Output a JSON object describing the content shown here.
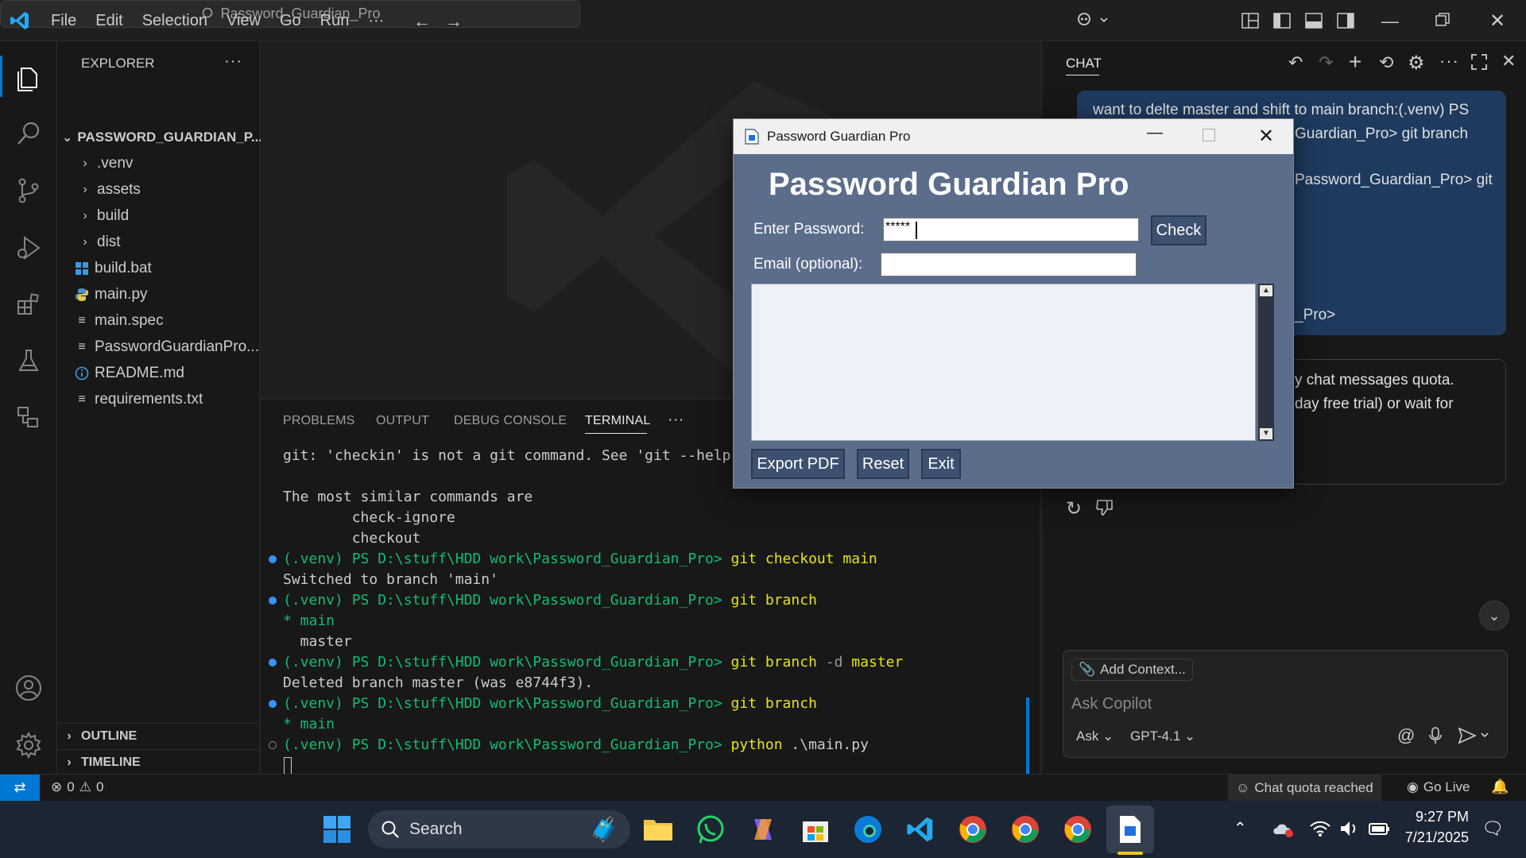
{
  "menubar": {
    "items": [
      "File",
      "Edit",
      "Selection",
      "View",
      "Go",
      "Run",
      "···"
    ],
    "search_text": "Password_Guardian_Pro"
  },
  "explorer": {
    "header": "EXPLORER",
    "root": "PASSWORD_GUARDIAN_P...",
    "folders": [
      ".venv",
      "assets",
      "build",
      "dist"
    ],
    "files": [
      "build.bat",
      "main.py",
      "main.spec",
      "PasswordGuardianPro...",
      "README.md",
      "requirements.txt"
    ],
    "outline": "OUTLINE",
    "timeline": "TIMELINE"
  },
  "panel": {
    "tabs": [
      "PROBLEMS",
      "OUTPUT",
      "DEBUG CONSOLE",
      "TERMINAL"
    ],
    "active_tab": "TERMINAL",
    "more": "···"
  },
  "terminal": {
    "prompt": "(.venv) PS D:\\stuff\\HDD work\\Password_Guardian_Pro>",
    "lines": {
      "l1": "git: 'checkin' is not a git command. See 'git --help'.",
      "l2": "The most similar commands are",
      "l3": "        check-ignore",
      "l4": "        checkout",
      "c1": "git checkout main",
      "l5": "Switched to branch 'main'",
      "c2": "git branch",
      "l6": "* main",
      "l7": "  master",
      "c3_cmd": "git branch",
      "c3_flag": "-d",
      "c3_arg": "master",
      "l8": "Deleted branch master (was e8744f3).",
      "c4": "git branch",
      "l9": "* main",
      "c5_cmd": "python",
      "c5_arg": ".\\main.py"
    }
  },
  "chat": {
    "header": "CHAT",
    "user_msg_1": "want to delte master and shift to main branch:(.venv) PS",
    "user_msg_2": "Guardian_Pro> git branch",
    "user_msg_3": "Password_Guardian_Pro> git",
    "user_msg_4": "_Pro>",
    "resp_1": "y chat messages quota.",
    "resp_2": "day free trial) or wait for",
    "add_context": "Add Context...",
    "input_placeholder": "Ask Copilot",
    "mode": "Ask",
    "model": "GPT-4.1"
  },
  "statusbar": {
    "errors": "0",
    "warnings": "0",
    "chat_quota": "Chat quota reached",
    "go_live": "Go Live"
  },
  "taskbar": {
    "search": "Search",
    "time": "9:27 PM",
    "date": "7/21/2025"
  },
  "tkapp": {
    "window_title": "Password Guardian Pro",
    "heading": "Password Guardian Pro",
    "password_label": "Enter Password:",
    "password_value": "*****",
    "email_label": "Email (optional):",
    "check_btn": "Check",
    "export_btn": "Export PDF",
    "reset_btn": "Reset",
    "exit_btn": "Exit"
  }
}
